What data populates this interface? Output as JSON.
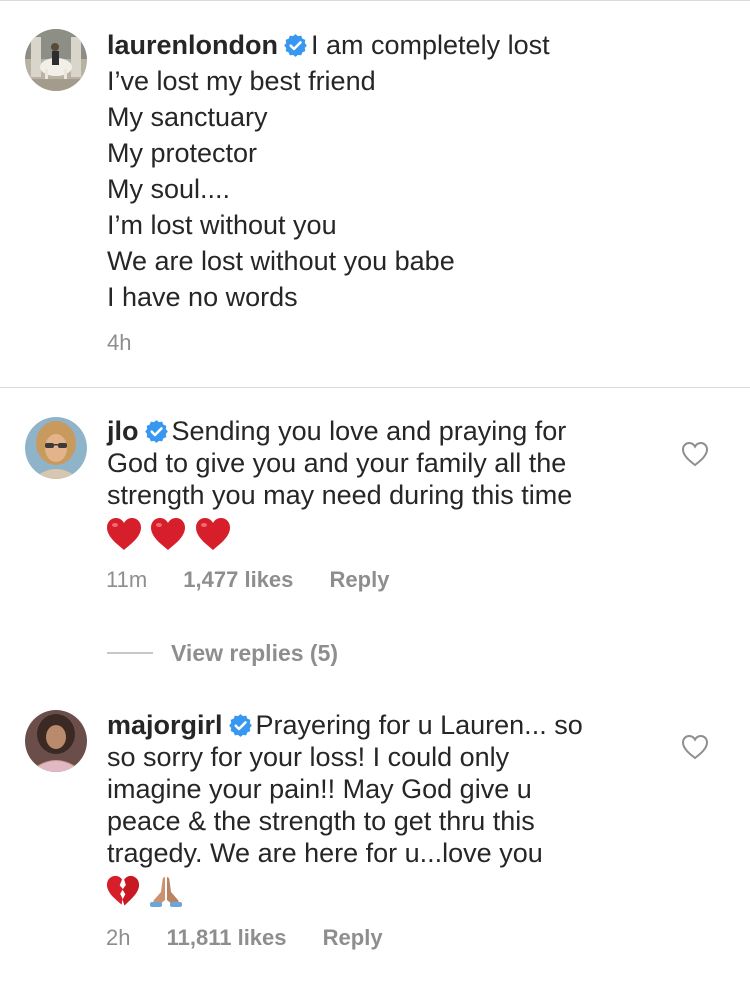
{
  "caption": {
    "username": "laurenlondon",
    "lines": [
      "I am completely lost",
      "I’ve lost my best friend",
      "My sanctuary",
      "My protector",
      "My soul....",
      "I’m lost without you",
      "We are lost without you babe",
      "I have no words"
    ],
    "time": "4h"
  },
  "comments": [
    {
      "username": "jlo",
      "lines": [
        "Sending you love and praying for",
        "God to give you and your family all the",
        "strength you may need during this time"
      ],
      "emojis": [
        "red-heart",
        "red-heart",
        "red-heart"
      ],
      "time": "11m",
      "likes": "1,477 likes",
      "reply_label": "Reply",
      "view_replies": "View replies (5)"
    },
    {
      "username": "majorgirl",
      "lines": [
        "Prayering for u Lauren... so",
        "so sorry for your loss! I could only",
        "imagine your pain!! May God give u",
        "peace & the strength to get thru this",
        "tragedy. We are here for u...love you"
      ],
      "emojis": [
        "broken-heart",
        "folded-hands"
      ],
      "time": "2h",
      "likes": "11,811 likes",
      "reply_label": "Reply"
    }
  ],
  "colors": {
    "text": "#262626",
    "secondary": "#8e8e8e",
    "verified": "#3897f0",
    "divider": "#dbdbdb",
    "heart_emoji": "#d61f2a"
  }
}
